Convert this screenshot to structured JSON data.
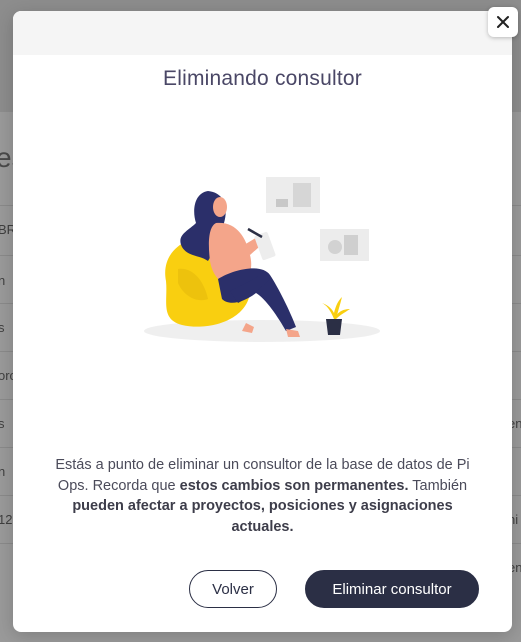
{
  "background": {
    "heading_fragment": "es",
    "left_fragments": [
      "BR",
      "n",
      "s",
      "oro",
      "s",
      "n",
      "12"
    ],
    "right_fragments": [
      "en",
      "ni",
      "en"
    ]
  },
  "modal": {
    "title": "Eliminando consultor",
    "message": {
      "part1": "Estás a punto de eliminar un consultor de la base de datos de Pi Ops. Recorda que ",
      "bold1": "estos cambios son permanentes.",
      "part2": " También ",
      "bold2": "pueden afectar a proyectos, posiciones y asignaciones actuales."
    },
    "back_label": "Volver",
    "delete_label": "Eliminar consultor"
  },
  "icons": {
    "close": "close-icon",
    "illustration": "woman-reading-illustration"
  },
  "colors": {
    "primary": "#2b2f45",
    "accent_yellow": "#f9cf10",
    "title": "#4a4766"
  }
}
